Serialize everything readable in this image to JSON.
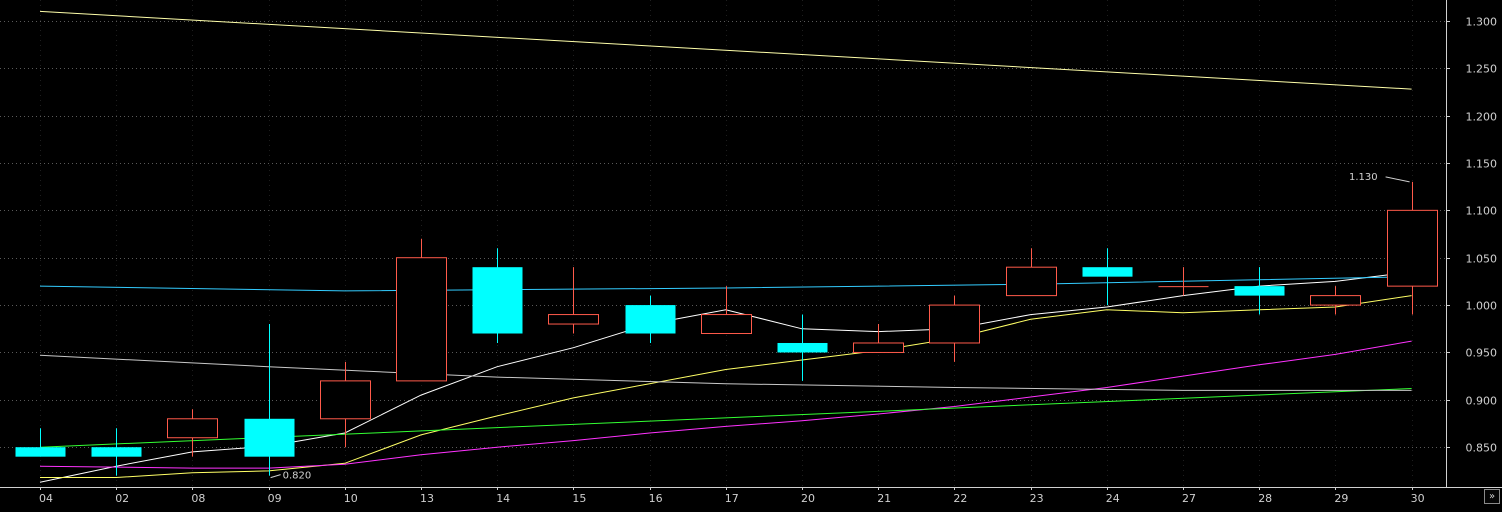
{
  "colors": {
    "background": "#000000",
    "grid": "#5a5a5a",
    "axis_text": "#d0d0d0",
    "up": "#ff5a4a",
    "down": "#00ffff",
    "ma_white": "#ffffff",
    "ma_yellow": "#ffff66",
    "ma_magenta": "#ff33ff",
    "ma_green": "#33ff33",
    "ma_cyan": "#33ccff",
    "ma_gray": "#c8c8c8",
    "ma_lightyellow": "#ffffaa"
  },
  "scroll_button": {
    "label": "»",
    "icon": "double-chevron-right-icon"
  },
  "chart_data": {
    "type": "candlestick",
    "categories": [
      "04",
      "02",
      "08",
      "09",
      "10",
      "13",
      "14",
      "15",
      "16",
      "17",
      "20",
      "21",
      "22",
      "23",
      "24",
      "27",
      "28",
      "29",
      "30"
    ],
    "candles": [
      {
        "date": "04",
        "open": 0.85,
        "close": 0.84,
        "high": 0.87,
        "low": 0.84
      },
      {
        "date": "02",
        "open": 0.85,
        "close": 0.84,
        "high": 0.87,
        "low": 0.82
      },
      {
        "date": "08",
        "open": 0.86,
        "close": 0.88,
        "high": 0.89,
        "low": 0.84
      },
      {
        "date": "09",
        "open": 0.88,
        "close": 0.84,
        "high": 0.98,
        "low": 0.82
      },
      {
        "date": "10",
        "open": 0.88,
        "close": 0.92,
        "high": 0.94,
        "low": 0.85
      },
      {
        "date": "13",
        "open": 0.92,
        "close": 1.05,
        "high": 1.07,
        "low": 0.92
      },
      {
        "date": "14",
        "open": 1.04,
        "close": 0.97,
        "high": 1.06,
        "low": 0.96
      },
      {
        "date": "15",
        "open": 0.98,
        "close": 0.99,
        "high": 1.04,
        "low": 0.97
      },
      {
        "date": "16",
        "open": 1.0,
        "close": 0.97,
        "high": 1.01,
        "low": 0.96
      },
      {
        "date": "17",
        "open": 0.97,
        "close": 0.99,
        "high": 1.02,
        "low": 0.97
      },
      {
        "date": "20",
        "open": 0.96,
        "close": 0.95,
        "high": 0.99,
        "low": 0.92
      },
      {
        "date": "21",
        "open": 0.95,
        "close": 0.96,
        "high": 0.98,
        "low": 0.95
      },
      {
        "date": "22",
        "open": 0.96,
        "close": 1.0,
        "high": 1.01,
        "low": 0.94
      },
      {
        "date": "23",
        "open": 1.01,
        "close": 1.04,
        "high": 1.06,
        "low": 1.01
      },
      {
        "date": "24",
        "open": 1.04,
        "close": 1.03,
        "high": 1.06,
        "low": 1.0
      },
      {
        "date": "27",
        "open": 1.02,
        "close": 1.02,
        "high": 1.04,
        "low": 1.01
      },
      {
        "date": "28",
        "open": 1.02,
        "close": 1.01,
        "high": 1.04,
        "low": 0.99
      },
      {
        "date": "29",
        "open": 1.0,
        "close": 1.01,
        "high": 1.02,
        "low": 0.99
      },
      {
        "date": "30",
        "open": 1.02,
        "close": 1.1,
        "high": 1.13,
        "low": 0.99
      }
    ],
    "series": [
      {
        "color": "#ffffff",
        "x": [
          0,
          1,
          2,
          3,
          4,
          5,
          6,
          7,
          8,
          9,
          10,
          11,
          12,
          13,
          14,
          15,
          16,
          17,
          18
        ],
        "values": [
          0.813,
          0.83,
          0.845,
          0.851,
          0.865,
          0.905,
          0.935,
          0.955,
          0.98,
          0.995,
          0.975,
          0.972,
          0.975,
          0.99,
          0.998,
          1.01,
          1.02,
          1.025,
          1.035
        ]
      },
      {
        "color": "#ffff66",
        "x": [
          0,
          1,
          2,
          3,
          4,
          5,
          6,
          7,
          8,
          9,
          10,
          11,
          12,
          13,
          14,
          15,
          16,
          17,
          18
        ],
        "values": [
          0.818,
          0.818,
          0.823,
          0.825,
          0.833,
          0.863,
          0.883,
          0.902,
          0.917,
          0.932,
          0.942,
          0.952,
          0.965,
          0.985,
          0.995,
          0.992,
          0.995,
          0.998,
          1.01
        ]
      },
      {
        "color": "#ff33ff",
        "x": [
          0,
          1,
          2,
          3,
          4,
          5,
          6,
          7,
          8,
          9,
          10,
          11,
          12,
          13,
          14,
          15,
          16,
          17,
          18
        ],
        "values": [
          0.83,
          0.829,
          0.828,
          0.828,
          0.832,
          0.842,
          0.85,
          0.857,
          0.865,
          0.872,
          0.878,
          0.885,
          0.893,
          0.903,
          0.913,
          0.925,
          0.937,
          0.948,
          0.962
        ]
      },
      {
        "color": "#33ff33",
        "x": [
          0,
          18
        ],
        "values": [
          0.85,
          0.912
        ]
      },
      {
        "color": "#33ccff",
        "x": [
          0,
          4,
          9,
          13,
          18
        ],
        "values": [
          1.02,
          1.015,
          1.018,
          1.022,
          1.03
        ]
      },
      {
        "color": "#c8c8c8",
        "x": [
          0,
          3,
          6,
          9,
          12,
          15,
          18
        ],
        "values": [
          0.947,
          0.935,
          0.924,
          0.917,
          0.913,
          0.91,
          0.91
        ]
      },
      {
        "color": "#ffffaa",
        "x": [
          0,
          18
        ],
        "values": [
          1.31,
          1.228
        ]
      }
    ],
    "annotations": [
      {
        "text": "1.130",
        "index": 18,
        "value": 1.13,
        "type": "high"
      },
      {
        "text": "0.820",
        "index": 3,
        "value": 0.82,
        "type": "low"
      }
    ],
    "y_ticks": [
      "1.300",
      "1.250",
      "1.200",
      "1.150",
      "1.100",
      "1.050",
      "1.000",
      "0.950",
      "0.900",
      "0.850"
    ],
    "ylim": [
      0.808,
      1.322
    ],
    "grid": true,
    "y_axis_position": "right"
  }
}
